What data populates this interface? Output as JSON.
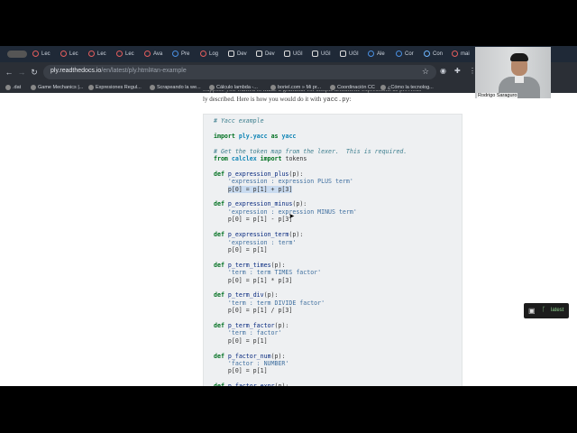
{
  "browser": {
    "tabs": [
      {
        "label": "Lec",
        "icon": "red"
      },
      {
        "label": "Lec",
        "icon": "red"
      },
      {
        "label": "Lec",
        "icon": "red"
      },
      {
        "label": "Lec",
        "icon": "red"
      },
      {
        "label": "Ava",
        "icon": "red"
      },
      {
        "label": "Pre",
        "icon": "blue"
      },
      {
        "label": "Log",
        "icon": "red"
      },
      {
        "label": "Dev",
        "icon": "gh"
      },
      {
        "label": "Dev",
        "icon": "gh"
      },
      {
        "label": "UGI",
        "icon": "gh"
      },
      {
        "label": "UGI",
        "icon": "gh"
      },
      {
        "label": "UGI",
        "icon": "gh"
      },
      {
        "label": "Ale",
        "icon": "blue"
      },
      {
        "label": "Cor",
        "icon": "blue"
      },
      {
        "label": "Con",
        "icon": "wav"
      },
      {
        "label": "mai",
        "icon": "red"
      }
    ],
    "url_host": "ply.readthedocs.io",
    "url_path": "/en/latest/ply.html#an-example",
    "bookmarks": [
      ".dat",
      "Game Mechanics |...",
      "Expresiones Regul...",
      "Scrapeando la we...",
      "Cálculo lambda -...",
      "boriel.com » Mi pr...",
      "Coordinación CC",
      "¿Cómo la tecnolog..."
    ]
  },
  "page": {
    "intro_line1": "Suppose you wanted to make a grammar for simple arithmetic expressions as previous-",
    "intro_line2_prefix": "ly described. Here is how you would do it with ",
    "intro_code": "yacc.py",
    "intro_line2_suffix": ":"
  },
  "code": {
    "c1": "# Yacc example",
    "kw_import": "import",
    "mod_yacc": "ply.yacc",
    "kw_as": "as",
    "alias_yacc": "yacc",
    "c2": "# Get the token map from the lexer.  This is required.",
    "kw_from": "from",
    "mod_calclex": "calclex",
    "kw_import2": "import",
    "name_tokens": "tokens",
    "functions": [
      {
        "name": "p_expression_plus",
        "doc": "'expression : expression PLUS term'",
        "body": "p[0] = p[1] + p[3]"
      },
      {
        "name": "p_expression_minus",
        "doc": "'expression : expression MINUS term'",
        "body": "p[0] = p[1] - p[3]"
      },
      {
        "name": "p_expression_term",
        "doc": "'expression : term'",
        "body": "p[0] = p[1]"
      },
      {
        "name": "p_term_times",
        "doc": "'term : term TIMES factor'",
        "body": "p[0] = p[1] * p[3]"
      },
      {
        "name": "p_term_div",
        "doc": "'term : term DIVIDE factor'",
        "body": "p[0] = p[1] / p[3]"
      },
      {
        "name": "p_term_factor",
        "doc": "'term : factor'",
        "body": "p[0] = p[1]"
      },
      {
        "name": "p_factor_num",
        "doc": "'factor : NUMBER'",
        "body": "p[0] = p[1]"
      },
      {
        "name": "p_factor_expr",
        "doc": "",
        "body": ""
      }
    ],
    "kw_def": "def",
    "param": "(p):"
  },
  "rtd_badge": {
    "version": "latest"
  },
  "webcam": {
    "name": "Rodrigo Saraguro"
  },
  "colors": {
    "highlight": "#c9dbf0",
    "code_bg": "#eef0f2"
  }
}
